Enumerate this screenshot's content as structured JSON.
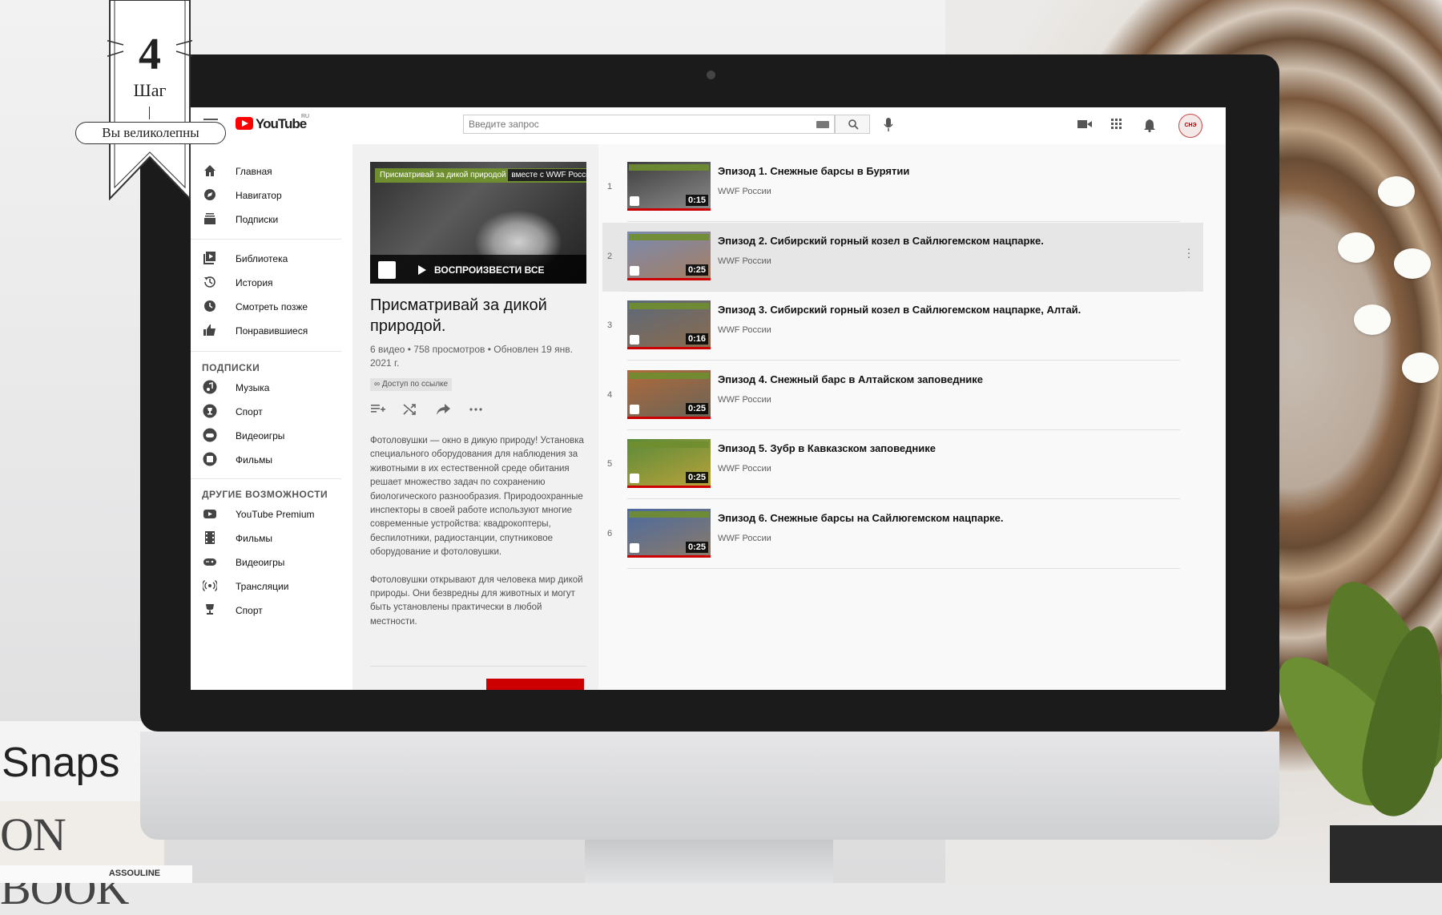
{
  "badge": {
    "number": "4",
    "word": "Шаг",
    "pill": "Вы великолепны"
  },
  "background": {
    "book_top": "Snaps",
    "book_mid": "ON BOOK",
    "book_bottom": "ASSOULINE"
  },
  "header": {
    "logo_text": "YouTube",
    "logo_region": "RU",
    "search_placeholder": "Введите запрос",
    "avatar_text": "СНЭ"
  },
  "sidebar": {
    "main": [
      {
        "label": "Главная",
        "icon": "home-icon"
      },
      {
        "label": "Навигатор",
        "icon": "compass-icon"
      },
      {
        "label": "Подписки",
        "icon": "subscriptions-icon"
      }
    ],
    "library": [
      {
        "label": "Библиотека",
        "icon": "library-icon"
      },
      {
        "label": "История",
        "icon": "history-icon"
      },
      {
        "label": "Смотреть позже",
        "icon": "clock-icon"
      },
      {
        "label": "Понравившиеся",
        "icon": "thumb-up-icon"
      }
    ],
    "subs_heading": "ПОДПИСКИ",
    "subs": [
      {
        "label": "Музыка",
        "icon": "music-icon"
      },
      {
        "label": "Спорт",
        "icon": "trophy-icon"
      },
      {
        "label": "Видеоигры",
        "icon": "gamepad-icon"
      },
      {
        "label": "Фильмы",
        "icon": "film-icon"
      }
    ],
    "other_heading": "ДРУГИЕ ВОЗМОЖНОСТИ",
    "other": [
      {
        "label": "YouTube Premium",
        "icon": "youtube-icon"
      },
      {
        "label": "Фильмы",
        "icon": "film-strip-icon"
      },
      {
        "label": "Видеоигры",
        "icon": "gamepad-icon"
      },
      {
        "label": "Трансляции",
        "icon": "broadcast-icon"
      },
      {
        "label": "Спорт",
        "icon": "trophy-icon"
      }
    ]
  },
  "playlist": {
    "thumb_banner_a": "Присматривай за дикой природой",
    "thumb_banner_b": "вместе с WWF России",
    "play_all": "ВОСПРОИЗВЕСТИ ВСЕ",
    "title": "Присматривай за дикой природой.",
    "meta": "6 видео • 758 просмотров • Обновлен 19 янв. 2021 г.",
    "access": "Доступ по ссылке",
    "description_1": "Фотоловушки — окно в дикую природу! Установка специального оборудования для наблюдения за животными в их естественной среде обитания решает множество задач по сохранению биологического разнообразия. Природоохранные инспекторы в своей работе используют многие современные устройства: квадрокоптеры, беспилотники, радиостанции, спутниковое оборудование и фотоловушки.",
    "description_2": "Фотоловушки открывают для человека мир дикой природы. Они безвредны для животных и могут быть установлены практически в любой местности."
  },
  "videos": [
    {
      "num": "1",
      "title": "Эпизод 1. Снежные барсы в Бурятии",
      "channel": "WWF России",
      "duration": "0:15",
      "colors": [
        "#3d3d3d",
        "#8a8a8a"
      ]
    },
    {
      "num": "2",
      "title": "Эпизод 2. Сибирский горный козел в Сайлюгемском нацпарке.",
      "channel": "WWF России",
      "duration": "0:25",
      "colors": [
        "#7a8ab0",
        "#a57f64"
      ]
    },
    {
      "num": "3",
      "title": "Эпизод 3. Сибирский горный козел в Сайлюгемском нацпарке, Алтай.",
      "channel": "WWF России",
      "duration": "0:16",
      "colors": [
        "#5c6a7a",
        "#8a6b4e"
      ]
    },
    {
      "num": "4",
      "title": "Эпизод 4. Снежный барс в Алтайском заповеднике",
      "channel": "WWF России",
      "duration": "0:25",
      "colors": [
        "#b06a3a",
        "#6a6458"
      ]
    },
    {
      "num": "5",
      "title": "Эпизод 5. Зубр в Кавказском заповеднике",
      "channel": "WWF России",
      "duration": "0:25",
      "colors": [
        "#5a8a3a",
        "#b8a23a"
      ]
    },
    {
      "num": "6",
      "title": "Эпизод 6. Снежные барсы на Сайлюгемском нацпарке.",
      "channel": "WWF России",
      "duration": "0:25",
      "colors": [
        "#4a6aa0",
        "#8a7a6a"
      ]
    }
  ]
}
